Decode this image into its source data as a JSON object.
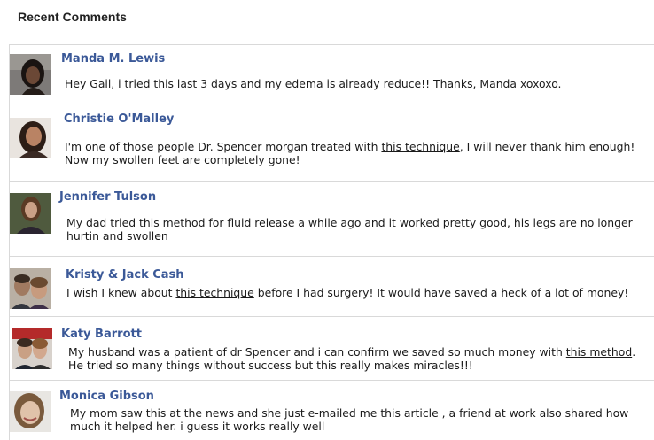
{
  "widget": {
    "title": "Recent Comments"
  },
  "comments": [
    {
      "name": "Manda M. Lewis",
      "pre": "Hey Gail, i tried this last 3 days and my edema is already reduce!! Thanks, Manda xoxoxo.",
      "link": "",
      "post": ""
    },
    {
      "name": "Christie O'Malley",
      "pre": "I'm one of those people Dr. Spencer morgan treated with ",
      "link": "this technique",
      "post": ", I will never thank him enough! Now my swollen feet are completely gone!"
    },
    {
      "name": "Jennifer Tulson",
      "pre": "My dad tried ",
      "link": "this method for fluid release",
      "post": " a while ago and it worked pretty good, his legs are no longer hurtin and swollen"
    },
    {
      "name": "Kristy & Jack Cash",
      "pre": "I wish I knew about ",
      "link": "this technique",
      "post": " before I had surgery! It would have saved a heck of a lot of money!"
    },
    {
      "name": "Katy Barrott",
      "pre": "My husband was a patient of dr Spencer and i can confirm we saved so much money with ",
      "link": "this method",
      "post": ". He tried so many things without success but this really makes miracles!!!"
    },
    {
      "name": "Monica Gibson",
      "pre": "My mom saw this at the news and she just e-mailed me this article , a friend at work also shared how much it helped her. i guess it works really well",
      "link": "",
      "post": ""
    }
  ]
}
